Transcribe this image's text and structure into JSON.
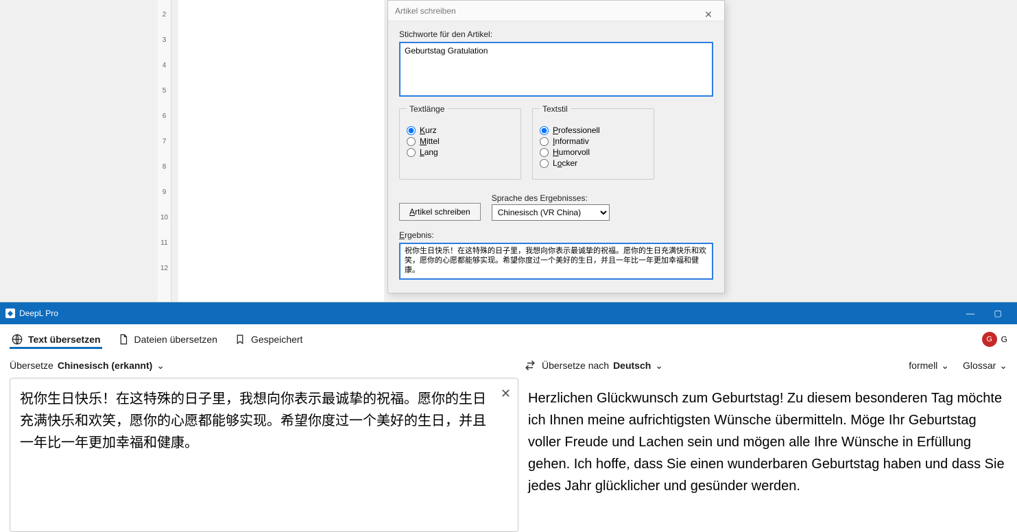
{
  "ruler": {
    "ticks": [
      "2",
      "3",
      "4",
      "5",
      "6",
      "7",
      "8",
      "9",
      "10",
      "11",
      "12"
    ]
  },
  "dialog": {
    "title": "Artikel schreiben",
    "keywords_label": "Stichworte für den Artikel:",
    "keywords_value": "Geburtstag Gratulation",
    "textlength_legend": "Textlänge",
    "len_kurz": "Kurz",
    "len_mittel": "Mittel",
    "len_lang": "Lang",
    "textstil_legend": "Textstil",
    "stil_professionell": "Professionell",
    "stil_informativ": "Informativ",
    "stil_humorvoll": "Humorvoll",
    "stil_locker": "Locker",
    "generate_btn": "Artikel schreiben",
    "lang_label": "Sprache des Ergebnisses:",
    "lang_value": "Chinesisch (VR China)",
    "result_label": "Ergebnis:",
    "result_value": "祝你生日快乐！在这特殊的日子里，我想向你表示最诚挚的祝福。愿你的生日充满快乐和欢笑，愿你的心愿都能够实现。希望你度过一个美好的生日，并且一年比一年更加幸福和健康。"
  },
  "deepl": {
    "title": "DeepL Pro",
    "tab_translate_text": "Text übersetzen",
    "tab_translate_files": "Dateien übersetzen",
    "tab_saved": "Gespeichert",
    "user_initial": "G",
    "user_trail": "G",
    "src_lang_prefix": "Übersetze ",
    "src_lang_main": "Chinesisch (erkannt)",
    "dst_lang_prefix": "Übersetze nach ",
    "dst_lang_main": "Deutsch",
    "formality": "formell",
    "glossary": "Glossar",
    "source_text": "祝你生日快乐！在这特殊的日子里，我想向你表示最诚挚的祝福。愿你的生日充满快乐和欢笑，愿你的心愿都能够实现。希望你度过一个美好的生日，并且一年比一年更加幸福和健康。",
    "target_text": "Herzlichen Glückwunsch zum Geburtstag! Zu diesem besonderen Tag möchte ich Ihnen meine aufrichtigsten Wünsche übermitteln. Möge Ihr Geburtstag voller Freude und Lachen sein und mögen alle Ihre Wünsche in Erfüllung gehen. Ich hoffe, dass Sie einen wunderbaren Geburtstag haben und dass Sie jedes Jahr glücklicher und gesünder werden."
  }
}
